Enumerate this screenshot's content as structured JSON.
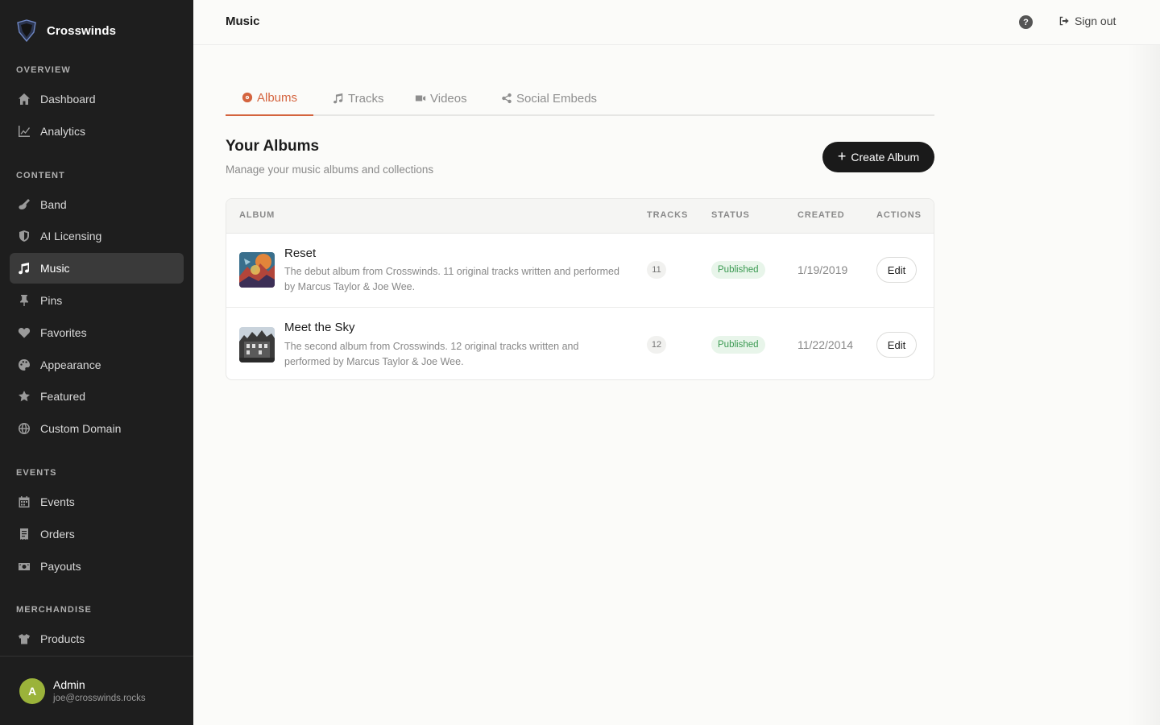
{
  "brand": {
    "name": "Crosswinds"
  },
  "sidebar": {
    "sections": {
      "overview": "OVERVIEW",
      "content": "CONTENT",
      "events": "EVENTS",
      "merchandise": "MERCHANDISE"
    },
    "items": [
      {
        "label": "Dashboard",
        "icon": "home-icon"
      },
      {
        "label": "Analytics",
        "icon": "chart-line-icon"
      },
      {
        "label": "Band",
        "icon": "guitar-icon"
      },
      {
        "label": "AI Licensing",
        "icon": "shield-icon"
      },
      {
        "label": "Music",
        "icon": "music-note-icon",
        "active": true
      },
      {
        "label": "Pins",
        "icon": "pin-icon"
      },
      {
        "label": "Favorites",
        "icon": "heart-icon"
      },
      {
        "label": "Appearance",
        "icon": "palette-icon"
      },
      {
        "label": "Featured",
        "icon": "star-icon"
      },
      {
        "label": "Custom Domain",
        "icon": "globe-icon"
      },
      {
        "label": "Events",
        "icon": "calendar-icon"
      },
      {
        "label": "Orders",
        "icon": "receipt-icon"
      },
      {
        "label": "Payouts",
        "icon": "money-icon"
      },
      {
        "label": "Products",
        "icon": "shirt-icon"
      }
    ],
    "user": {
      "initial": "A",
      "name": "Admin",
      "email": "joe@crosswinds.rocks"
    }
  },
  "header": {
    "title": "Music",
    "signout_label": "Sign out",
    "help_glyph": "?"
  },
  "tabs": [
    {
      "label": "Albums",
      "icon": "record-icon",
      "active": true
    },
    {
      "label": "Tracks",
      "icon": "music-note-icon"
    },
    {
      "label": "Videos",
      "icon": "video-camera-icon"
    },
    {
      "label": "Social Embeds",
      "icon": "share-icon"
    }
  ],
  "albums_section": {
    "title": "Your Albums",
    "subtitle": "Manage your music albums and collections",
    "create_label": "Create Album"
  },
  "table": {
    "columns": [
      "ALBUM",
      "TRACKS",
      "STATUS",
      "CREATED",
      "ACTIONS"
    ],
    "rows": [
      {
        "title": "Reset",
        "description": "The debut album from Crosswinds. 11 original tracks written and performed by Marcus Taylor & Joe Wee.",
        "tracks": "11",
        "status": "Published",
        "created": "1/19/2019",
        "action": "Edit"
      },
      {
        "title": "Meet the Sky",
        "description": "The second album from Crosswinds. 12 original tracks written and performed by Marcus Taylor & Joe Wee.",
        "tracks": "12",
        "status": "Published",
        "created": "11/22/2014",
        "action": "Edit"
      }
    ]
  },
  "colors": {
    "accent": "#d4643f",
    "sidebar_bg": "#1e1e1e",
    "published": "#3b9a52"
  }
}
